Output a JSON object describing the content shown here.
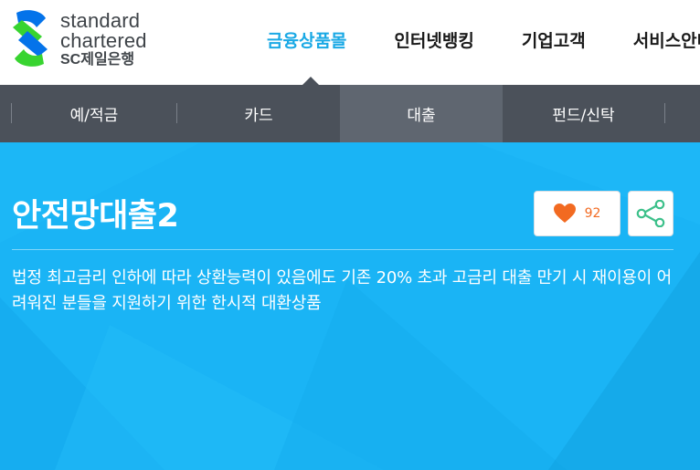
{
  "logo": {
    "line1": "standard",
    "line2": "chartered",
    "line3": "SC제일은행"
  },
  "gnb": {
    "items": [
      {
        "label": "금융상품몰",
        "active": true
      },
      {
        "label": "인터넷뱅킹",
        "active": false
      },
      {
        "label": "기업고객",
        "active": false
      },
      {
        "label": "서비스안내",
        "active": false
      }
    ]
  },
  "subnav": {
    "items": [
      {
        "label": "예/적금",
        "active": false
      },
      {
        "label": "카드",
        "active": false
      },
      {
        "label": "대출",
        "active": true
      },
      {
        "label": "펀드/신탁",
        "active": false
      }
    ]
  },
  "hero": {
    "title": "안전망대출2",
    "description": "법정 최고금리 인하에 따라 상환능력이 있음에도 기존 20% 초과 고금리 대출 만기 시 재이용이 어려워진 분들을 지원하기 위한 한시적 대환상품",
    "like_count": "92"
  },
  "colors": {
    "brand_blue": "#1aa9e5",
    "hero_bg": "#1ab4f5",
    "subnav_bg": "#4b515a",
    "subnav_active": "#5f6670",
    "like_orange": "#f26a21",
    "share_green": "#3cc08a",
    "logo_green": "#38d430",
    "logo_blue": "#0473ea"
  },
  "icons": {
    "logo": "sc-logo-icon",
    "like": "heart-icon",
    "share": "share-icon"
  }
}
